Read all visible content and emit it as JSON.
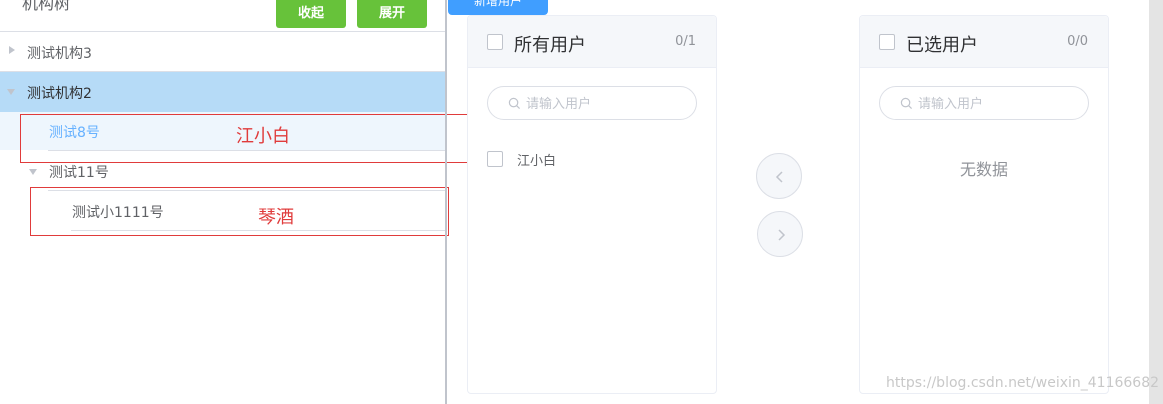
{
  "tree": {
    "title": "机构树",
    "collapse_label": "收起",
    "expand_label": "展开",
    "nodes": [
      {
        "label": "测试机构3"
      },
      {
        "label": "测试机构2"
      },
      {
        "label": "测试8号"
      },
      {
        "label": "测试11号"
      },
      {
        "label": "测试小1111号"
      }
    ]
  },
  "annotations": {
    "first": "江小白",
    "second": "琴酒"
  },
  "top_button": {
    "label": "新增用户"
  },
  "transfer": {
    "left": {
      "title": "所有用户",
      "count": "0/1",
      "search_placeholder": "请输入用户",
      "items": [
        {
          "label": "江小白"
        }
      ]
    },
    "right": {
      "title": "已选用户",
      "count": "0/0",
      "search_placeholder": "请输入用户",
      "empty_text": "无数据"
    }
  },
  "watermark": "https://blog.csdn.net/weixin_41166682",
  "colors": {
    "accent": "#409eff",
    "success": "#67c23a",
    "annotation": "#e03b3b",
    "selected_row": "#b6dbf7"
  },
  "icons": [
    "chevron-right-icon",
    "caret-down-icon",
    "search-icon",
    "chevron-left-icon"
  ]
}
